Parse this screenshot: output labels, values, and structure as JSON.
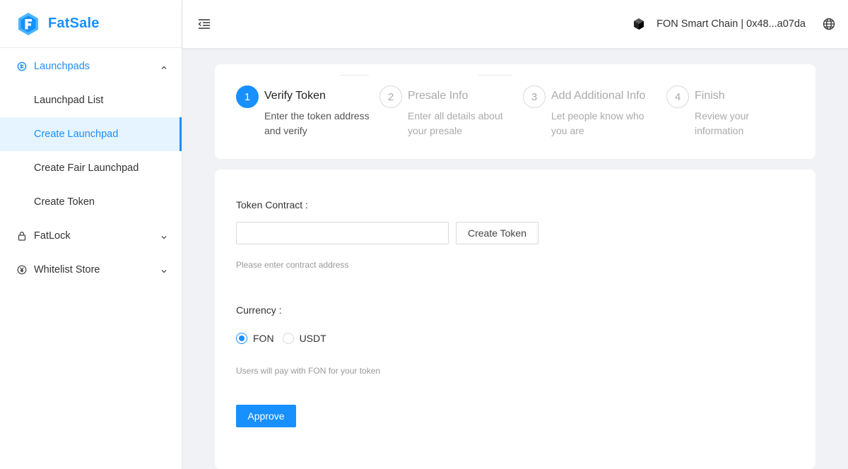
{
  "brand": {
    "name": "FatSale",
    "logo_icon": "fatsale-logo-icon",
    "accent_color": "#1890ff"
  },
  "sidebar": {
    "items": [
      {
        "label": "Launchpads",
        "icon": "launchpad-icon",
        "expanded": true
      },
      {
        "label": "Launchpad List"
      },
      {
        "label": "Create Launchpad",
        "active": true
      },
      {
        "label": "Create Fair Launchpad"
      },
      {
        "label": "Create Token"
      },
      {
        "label": "FatLock",
        "icon": "lock-icon"
      },
      {
        "label": "Whitelist Store",
        "icon": "yen-circle-icon"
      }
    ]
  },
  "header": {
    "menu_toggle_icon": "menu-fold-icon",
    "network_label": "FON Smart Chain | 0x48...a07da",
    "network_icon": "chain-cube-icon",
    "language_icon": "globe-icon"
  },
  "steps": [
    {
      "number": "1",
      "title": "Verify Token",
      "description": "Enter the token address and verify",
      "status": "current"
    },
    {
      "number": "2",
      "title": "Presale Info",
      "description": "Enter all details about your presale",
      "status": "wait"
    },
    {
      "number": "3",
      "title": "Add Additional Info",
      "description": "Let people know who you are",
      "status": "wait"
    },
    {
      "number": "4",
      "title": "Finish",
      "description": "Review your information",
      "status": "wait"
    }
  ],
  "form": {
    "token_contract_label": "Token Contract :",
    "token_contract_value": "",
    "token_contract_placeholder": "",
    "create_token_button": "Create Token",
    "contract_hint": "Please enter contract address",
    "currency_label": "Currency :",
    "currency_options": [
      {
        "label": "FON",
        "checked": true
      },
      {
        "label": "USDT",
        "checked": false
      }
    ],
    "currency_hint": "Users will pay with FON for your token",
    "approve_button": "Approve"
  }
}
